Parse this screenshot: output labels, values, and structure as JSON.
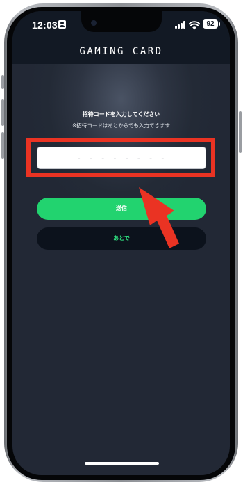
{
  "status_bar": {
    "time": "12:03",
    "battery_level": "92",
    "icons": [
      "person-icon",
      "signal-icon",
      "wifi-icon",
      "battery-icon"
    ]
  },
  "header": {
    "title": "GAMING CARD"
  },
  "invite": {
    "prompt": "招待コードを入力してください",
    "note": "※招待コードはあとからでも入力できます",
    "input_value": "",
    "input_placeholder": "- - - - - - - -"
  },
  "buttons": {
    "send_label": "送信",
    "later_label": "あとで"
  },
  "annotation": {
    "color": "#ea3323",
    "type": "arrow-and-highlight-box"
  },
  "colors": {
    "accent_green": "#22d36f",
    "later_text_green": "#2fe07f",
    "header_bg": "#121924",
    "screen_bg": "#232a36"
  }
}
